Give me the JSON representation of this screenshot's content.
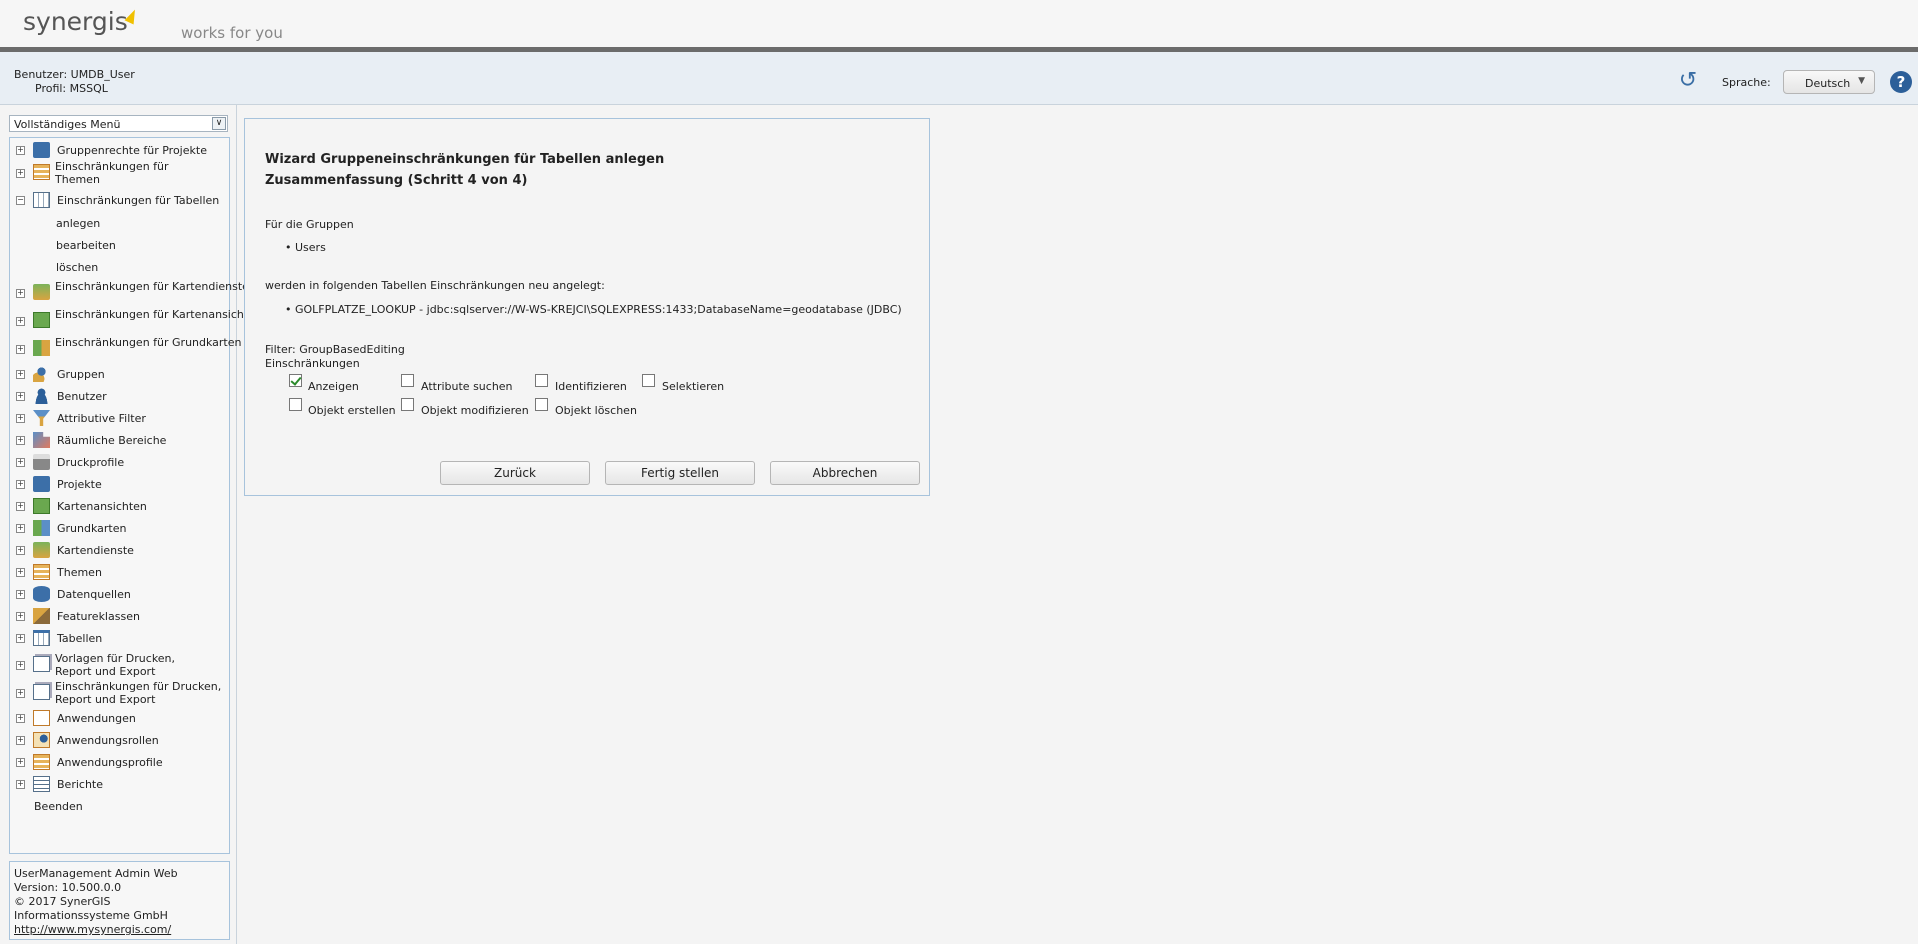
{
  "header": {
    "logo_text": "synergis",
    "tagline": "works for you"
  },
  "userbar": {
    "user_line": "Benutzer: UMDB_User",
    "profile_line": "Profil: MSSQL",
    "language_label": "Sprache:",
    "language_value": "Deutsch",
    "help_glyph": "?"
  },
  "sidebar": {
    "menu_select": "Vollständiges Menü",
    "items": [
      {
        "label": "Gruppenrechte für Projekte",
        "icon": "group-rights-icon"
      },
      {
        "label": "Einschränkungen für Themen",
        "icon": "theme-restrictions-icon"
      },
      {
        "label": "Einschränkungen für Tabellen",
        "icon": "table-restrictions-icon"
      },
      {
        "label": "Einschränkungen für Kartendienste",
        "icon": "mapservice-restrictions-icon"
      },
      {
        "label": "Einschränkungen für Kartenansichten",
        "icon": "mapview-restrictions-icon"
      },
      {
        "label": "Einschränkungen für Grundkarten",
        "icon": "basemap-restrictions-icon"
      },
      {
        "label": "Gruppen",
        "icon": "groups-icon"
      },
      {
        "label": "Benutzer",
        "icon": "user-icon"
      },
      {
        "label": "Attributive Filter",
        "icon": "filter-icon"
      },
      {
        "label": "Räumliche Bereiche",
        "icon": "spatial-area-icon"
      },
      {
        "label": "Druckprofile",
        "icon": "printer-icon"
      },
      {
        "label": "Projekte",
        "icon": "project-icon"
      },
      {
        "label": "Kartenansichten",
        "icon": "mapview-icon"
      },
      {
        "label": "Grundkarten",
        "icon": "basemap-icon"
      },
      {
        "label": "Kartendienste",
        "icon": "mapservice-icon"
      },
      {
        "label": "Themen",
        "icon": "themes-icon"
      },
      {
        "label": "Datenquellen",
        "icon": "datasource-icon"
      },
      {
        "label": "Featureklassen",
        "icon": "featureclass-icon"
      },
      {
        "label": "Tabellen",
        "icon": "table-icon"
      },
      {
        "label": "Vorlagen für Drucken, Report und Export",
        "icon": "template-icon"
      },
      {
        "label": "Einschränkungen für Drucken, Report und Export",
        "icon": "print-restrictions-icon"
      },
      {
        "label": "Anwendungen",
        "icon": "application-icon"
      },
      {
        "label": "Anwendungsrollen",
        "icon": "application-roles-icon"
      },
      {
        "label": "Anwendungsprofile",
        "icon": "application-profiles-icon"
      },
      {
        "label": "Berichte",
        "icon": "reports-icon"
      }
    ],
    "sub_items": [
      "anlegen",
      "bearbeiten",
      "löschen"
    ],
    "exit_label": "Beenden"
  },
  "footer": {
    "app_name": "UserManagement Admin Web",
    "version": "Version: 10.500.0.0",
    "copyright": "© 2017 SynerGIS Informationssysteme GmbH",
    "link": "http://www.mysynergis.com/"
  },
  "wizard": {
    "title": "Wizard Gruppeneinschränkungen für Tabellen anlegen",
    "step": "Zusammenfassung (Schritt 4 von 4)",
    "groups_intro": "Für die Gruppen",
    "groups": [
      "Users"
    ],
    "tables_intro": "werden in folgenden Tabellen Einschränkungen neu angelegt:",
    "tables": [
      "GOLFPLATZE_LOOKUP - jdbc:sqlserver://W-WS-KREJCI\\SQLEXPRESS:1433;DatabaseName=geodatabase (JDBC)"
    ],
    "filter": "Filter: GroupBasedEditing",
    "restrictions_label": "Einschränkungen",
    "checkboxes": [
      {
        "label": "Anzeigen",
        "checked": true
      },
      {
        "label": "Attribute suchen",
        "checked": false
      },
      {
        "label": "Identifizieren",
        "checked": false
      },
      {
        "label": "Selektieren",
        "checked": false
      },
      {
        "label": "Objekt erstellen",
        "checked": false
      },
      {
        "label": "Objekt modifizieren",
        "checked": false
      },
      {
        "label": "Objekt löschen",
        "checked": false
      }
    ],
    "buttons": {
      "back": "Zurück",
      "finish": "Fertig stellen",
      "cancel": "Abbrechen"
    }
  }
}
